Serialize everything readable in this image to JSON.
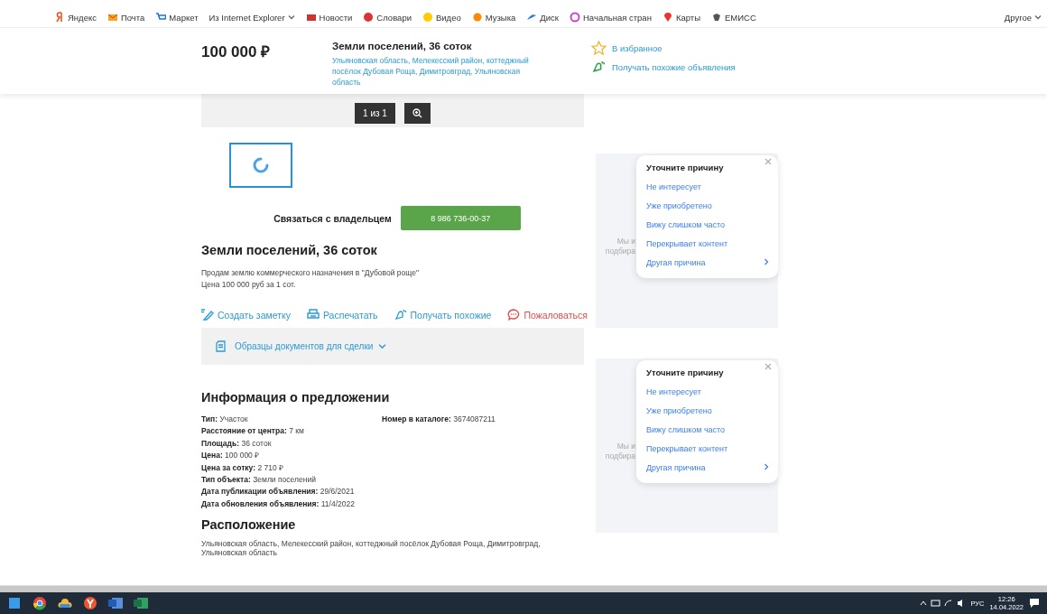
{
  "bookmarks": [
    {
      "label": "Яндекс",
      "kind": "ya"
    },
    {
      "label": "Почта",
      "kind": "mail"
    },
    {
      "label": "Маркет",
      "kind": "cart"
    },
    {
      "label": "Из Internet Explorer",
      "kind": "folder"
    },
    {
      "label": "Новости",
      "kind": "news"
    },
    {
      "label": "Словари",
      "kind": "dict"
    },
    {
      "label": "Видео",
      "kind": "video"
    },
    {
      "label": "Музыка",
      "kind": "music"
    },
    {
      "label": "Диск",
      "kind": "disk"
    },
    {
      "label": "Начальная стран",
      "kind": "home"
    },
    {
      "label": "Карты",
      "kind": "pin"
    },
    {
      "label": "ЕМИСС",
      "kind": "eagle"
    }
  ],
  "bookmarks_other": "Другое",
  "header": {
    "price": "100 000 ₽",
    "title": "Земли поселений, 36 соток",
    "address": "Ульяновская область, Мелекесский район, коттеджный посёлок Дубовая Роща, Димитровград, Ульяновская область",
    "favorite": "В избранное",
    "subscribe": "Получать похожие объявления"
  },
  "gallery": {
    "counter": "1 из 1"
  },
  "contact": {
    "label": "Связаться с владельцем",
    "phone": "8 986 736-00-37"
  },
  "listing": {
    "title": "Земли поселений, 36 соток",
    "description": [
      "Продам землю коммерческого назначения в \"Дубовой роще\"",
      "Цена 100 000 руб за 1 сот."
    ]
  },
  "actions": [
    {
      "label": "Создать заметку",
      "kind": "note"
    },
    {
      "label": "Распечатать",
      "kind": "print"
    },
    {
      "label": "Получать похожие",
      "kind": "subscribe"
    },
    {
      "label": "Пожаловаться",
      "kind": "complain"
    }
  ],
  "documents": {
    "label": "Образцы документов для сделки",
    "expanded": false
  },
  "info": {
    "heading": "Информация о предложении",
    "rows": [
      {
        "label": "Тип:",
        "value": "Участок"
      },
      {
        "label": "Расстояние от центра:",
        "value": "7 км"
      },
      {
        "label": "Площадь:",
        "value": "36 соток"
      },
      {
        "label": "Цена:",
        "value": "100 000 ₽"
      },
      {
        "label": "Цена за сотку:",
        "value": "2 710 ₽"
      },
      {
        "label": "Тип объекта:",
        "value": "Земли поселений"
      },
      {
        "label": "Дата публикации объявления:",
        "value": "29/6/2021"
      },
      {
        "label": "Дата обновления объявления:",
        "value": "11/4/2022"
      }
    ],
    "catalog": {
      "label": "Номер в каталоге:",
      "value": "3674087211"
    }
  },
  "location": {
    "heading": "Расположение",
    "address": "Ульяновская область, Мелекесский район, коттеджный посёлок Дубовая Роща, Димитровград, Ульяновская область"
  },
  "ads": [
    {
      "text": [
        "Мы и",
        "подбира"
      ],
      "popup": {
        "title": "Уточните причину",
        "reasons": [
          "Не интересует",
          "Уже приобретено",
          "Вижу слишком часто",
          "Перекрывает контент",
          "Другая причина"
        ]
      }
    },
    {
      "text": [
        "Мы и",
        "подбира"
      ],
      "popup": {
        "title": "Уточните причину",
        "reasons": [
          "Не интересует",
          "Уже приобретено",
          "Вижу слишком часто",
          "Перекрывает контент",
          "Другая причина"
        ]
      }
    }
  ],
  "taskbar": {
    "language": "РУС",
    "time": "12:26",
    "date": "14.04.2022"
  }
}
